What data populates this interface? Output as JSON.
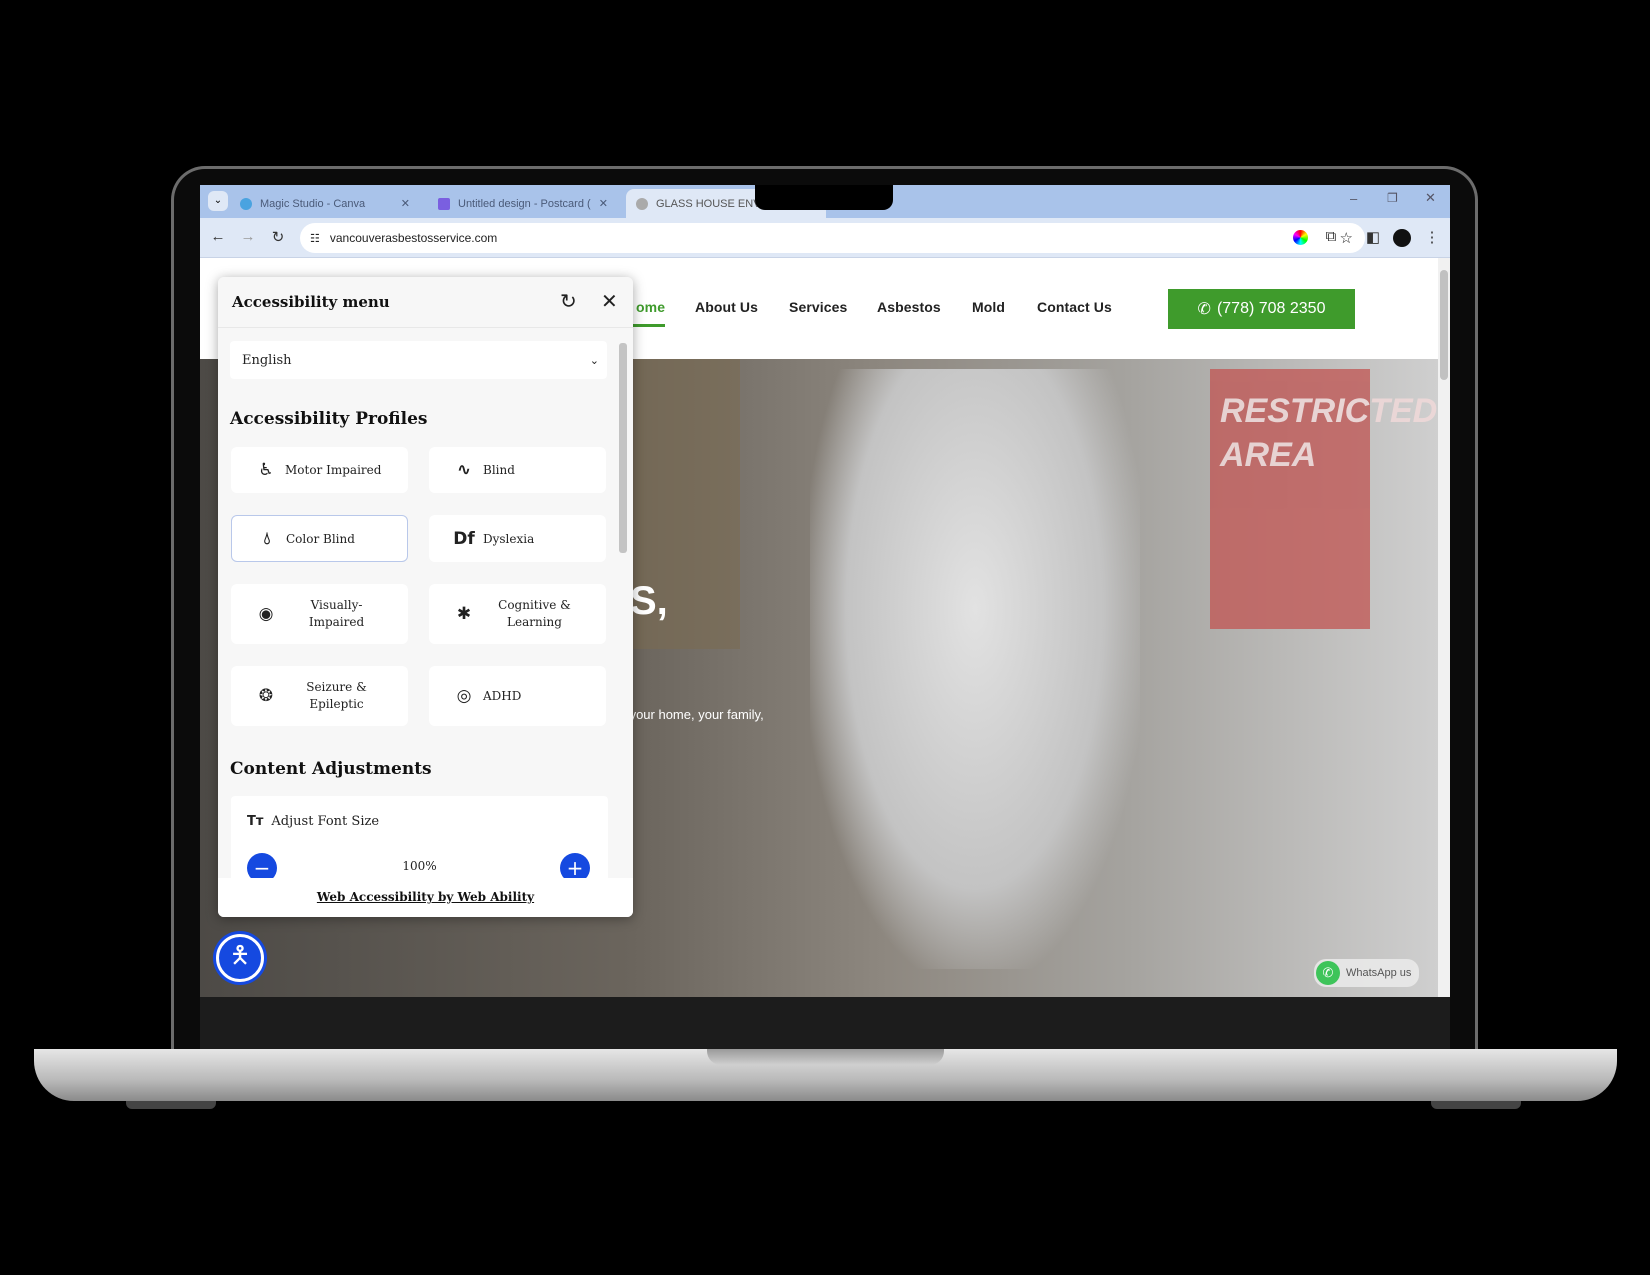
{
  "browser": {
    "tabs": [
      {
        "title": "Magic Studio - Canva",
        "favicon": "canva-icon",
        "active": false
      },
      {
        "title": "Untitled design - Postcard (US)",
        "favicon": "canva-print-icon",
        "active": false
      },
      {
        "title": "GLASS HOUSE ENVIRO",
        "favicon": "globe-icon",
        "active": true
      }
    ],
    "url": "vancouverasbestosservice.com"
  },
  "site": {
    "nav": [
      "ome",
      "About Us",
      "Services",
      "Asbestos",
      "Mold",
      "Contact Us"
    ],
    "active_nav": "Home",
    "phone": "(778) 708 2350",
    "hero_heading_fragment": "S,",
    "hero_text_fragment": "y of your home, your family,",
    "sign_text": "RESTRICTED AREA",
    "whatsapp": "WhatsApp us",
    "brand_color": "#3f9b2c"
  },
  "a11y": {
    "title": "Accessibility menu",
    "language": "English",
    "profiles_heading": "Accessibility Profiles",
    "profiles": [
      {
        "label": "Motor Impaired",
        "icon": "wheelchair-icon",
        "selected": false
      },
      {
        "label": "Blind",
        "icon": "waveform-icon",
        "selected": false
      },
      {
        "label": "Color Blind",
        "icon": "droplet-icon",
        "selected": true
      },
      {
        "label": "Dyslexia",
        "icon": "df-icon",
        "selected": false
      },
      {
        "label": "Visually-Impaired",
        "icon": "eye-icon",
        "selected": false
      },
      {
        "label": "Cognitive & Learning",
        "icon": "puzzle-icon",
        "selected": false
      },
      {
        "label": "Seizure & Epileptic",
        "icon": "brain-icon",
        "selected": false
      },
      {
        "label": "ADHD",
        "icon": "target-icon",
        "selected": false
      }
    ],
    "content_heading": "Content Adjustments",
    "font_size_label": "Adjust Font Size",
    "font_size_value": "100%",
    "footer_link": "Web Accessibility by Web Ability",
    "accent": "#1549e0"
  }
}
